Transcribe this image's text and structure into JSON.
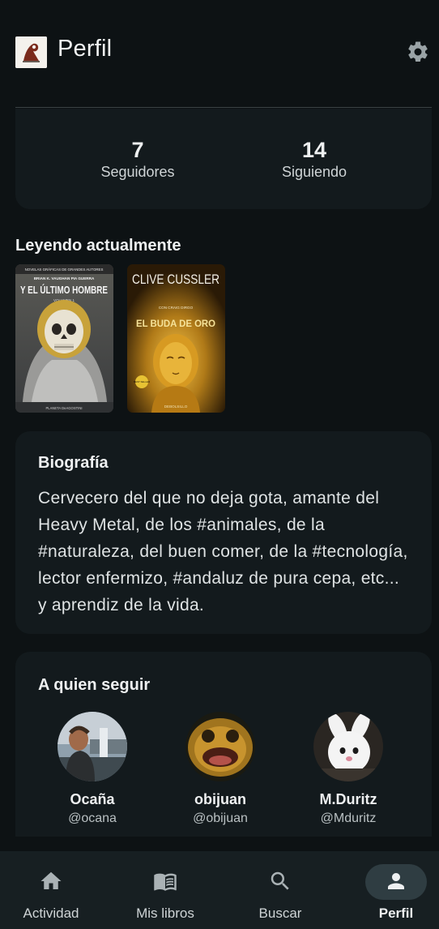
{
  "header": {
    "title": "Perfil"
  },
  "stats": {
    "followers_count": "7",
    "followers_label": "Seguidores",
    "following_count": "14",
    "following_label": "Siguiendo"
  },
  "reading": {
    "title": "Leyendo actualmente",
    "books": [
      {
        "cover_top": "NOVELAS GRÁFICAS DE GRANDES AUTORES",
        "authors": "BRIAN K. VAUGHAN  PIA GUERRA",
        "title": "Y EL ÚLTIMO HOMBRE",
        "volume": "VOLUMEN 1",
        "publisher": "PLANETA DeAGOSTINI"
      },
      {
        "author": "CLIVE CUSSLER",
        "coauthor": "CON CRAIG DIRGO",
        "title": "EL BUDA DE ORO",
        "badge": "BEST SELLER",
        "publisher": "DEBOLSILLO"
      }
    ]
  },
  "bio": {
    "title": "Biografía",
    "text": "Cervecero del que no deja gota, amante del Heavy Metal, de los #animales, de la #naturaleza, del buen comer, de la #tecnología, lector enfermizo, #andaluz de pura cepa, etc... y aprendiz de la vida."
  },
  "suggestions": {
    "title": "A quien seguir",
    "users": [
      {
        "name": "Ocaña",
        "handle": "@ocana"
      },
      {
        "name": "obijuan",
        "handle": "@obijuan"
      },
      {
        "name": "M.Duritz",
        "handle": "@Mduritz"
      }
    ]
  },
  "nav": {
    "items": [
      {
        "label": "Actividad",
        "icon": "home-icon"
      },
      {
        "label": "Mis libros",
        "icon": "book-icon"
      },
      {
        "label": "Buscar",
        "icon": "search-icon"
      },
      {
        "label": "Perfil",
        "icon": "person-icon"
      }
    ],
    "active": "Perfil"
  },
  "colors": {
    "background": "#0d1214",
    "card": "#131a1d",
    "nav": "#171f22",
    "active_pill": "#2f3d42"
  }
}
